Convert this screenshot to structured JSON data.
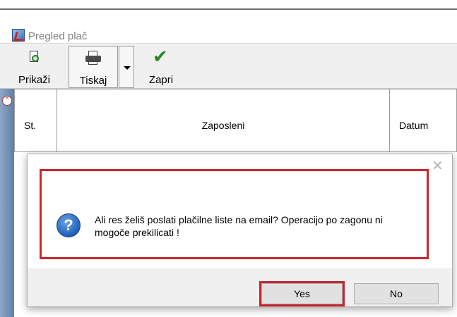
{
  "window": {
    "title": "Pregled plač"
  },
  "toolbar": {
    "prikazi_label": "Prikaži",
    "tiskaj_label": "Tiskaj",
    "zapri_label": "Zapri"
  },
  "grid": {
    "columns": [
      "St.",
      "Zaposleni",
      "Datum"
    ]
  },
  "dialog": {
    "message": "Ali res želiš poslati plačilne liste na email? Operacijo po zagonu ni mogoče prekilicati !",
    "yes_label": "Yes",
    "no_label": "No",
    "close_glyph": "✕"
  },
  "colors": {
    "highlight": "#c8262e",
    "title_text": "#808080",
    "grid_side_strip": "#6f8db5"
  }
}
